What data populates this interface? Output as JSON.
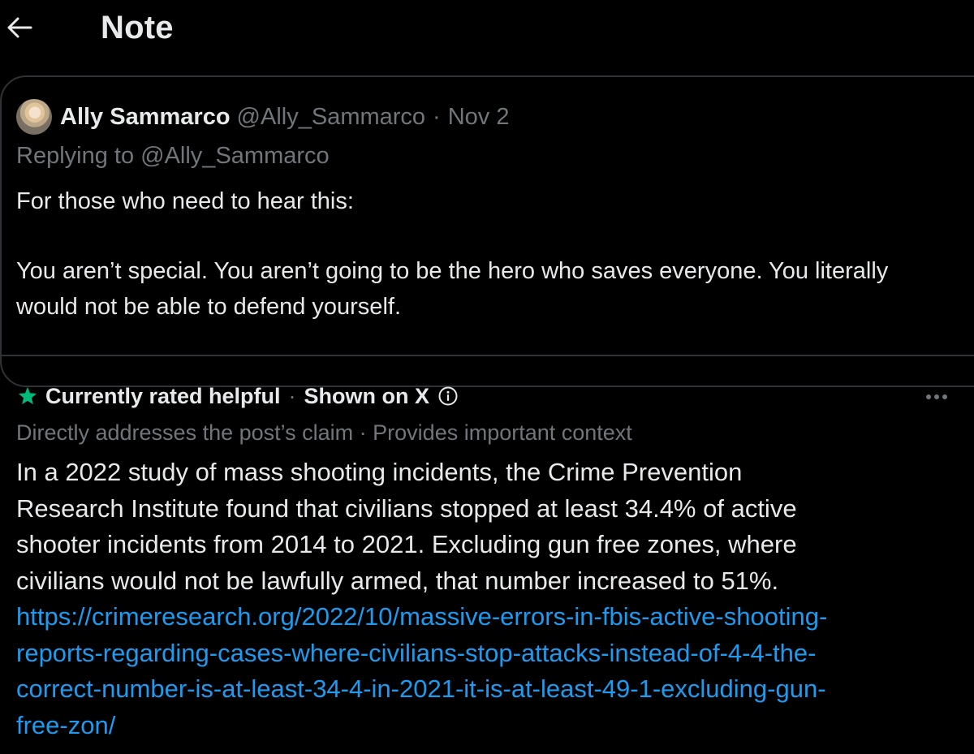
{
  "header": {
    "title": "Note"
  },
  "post": {
    "author_name": "Ally Sammarco",
    "handle": "@Ally_Sammarco",
    "separator": "·",
    "date": "Nov 2",
    "replying_to": "Replying to @Ally_Sammarco",
    "paragraph_1": "For those who need to hear this:",
    "paragraph_2": "You aren’t special. You aren’t going to be the hero who saves everyone. You literally would not be able to defend yourself."
  },
  "note": {
    "status_label": "Currently rated helpful",
    "separator": "·",
    "shown_label": "Shown on X",
    "tags": "Directly addresses the post’s claim · Provides important context",
    "body_text": "In a 2022 study of mass shooting incidents, the Crime Prevention Research Institute found that civilians stopped at least 34.4% of active shooter incidents from 2014 to 2021. Excluding gun free zones, where civilians would not be lawfully armed, that number increased to 51%. ",
    "link_text": "https://crimeresearch.org/2022/10/massive-errors-in-fbis-active-shooting-reports-regarding-cases-where-civilians-stop-attacks-instead-of-4-4-the-correct-number-is-at-least-34-4-in-2021-it-is-at-least-49-1-excluding-gun-free-zon/"
  },
  "icons": {
    "back": "arrow-left-icon",
    "status": "star-icon",
    "info": "info-icon",
    "more": "more-horizontal-icon"
  },
  "colors": {
    "background": "#000000",
    "text": "#e7e9ea",
    "secondary_text": "#71767b",
    "border": "#2f3336",
    "link": "#1d9bf0",
    "helpful_star": "#00ba7c"
  }
}
